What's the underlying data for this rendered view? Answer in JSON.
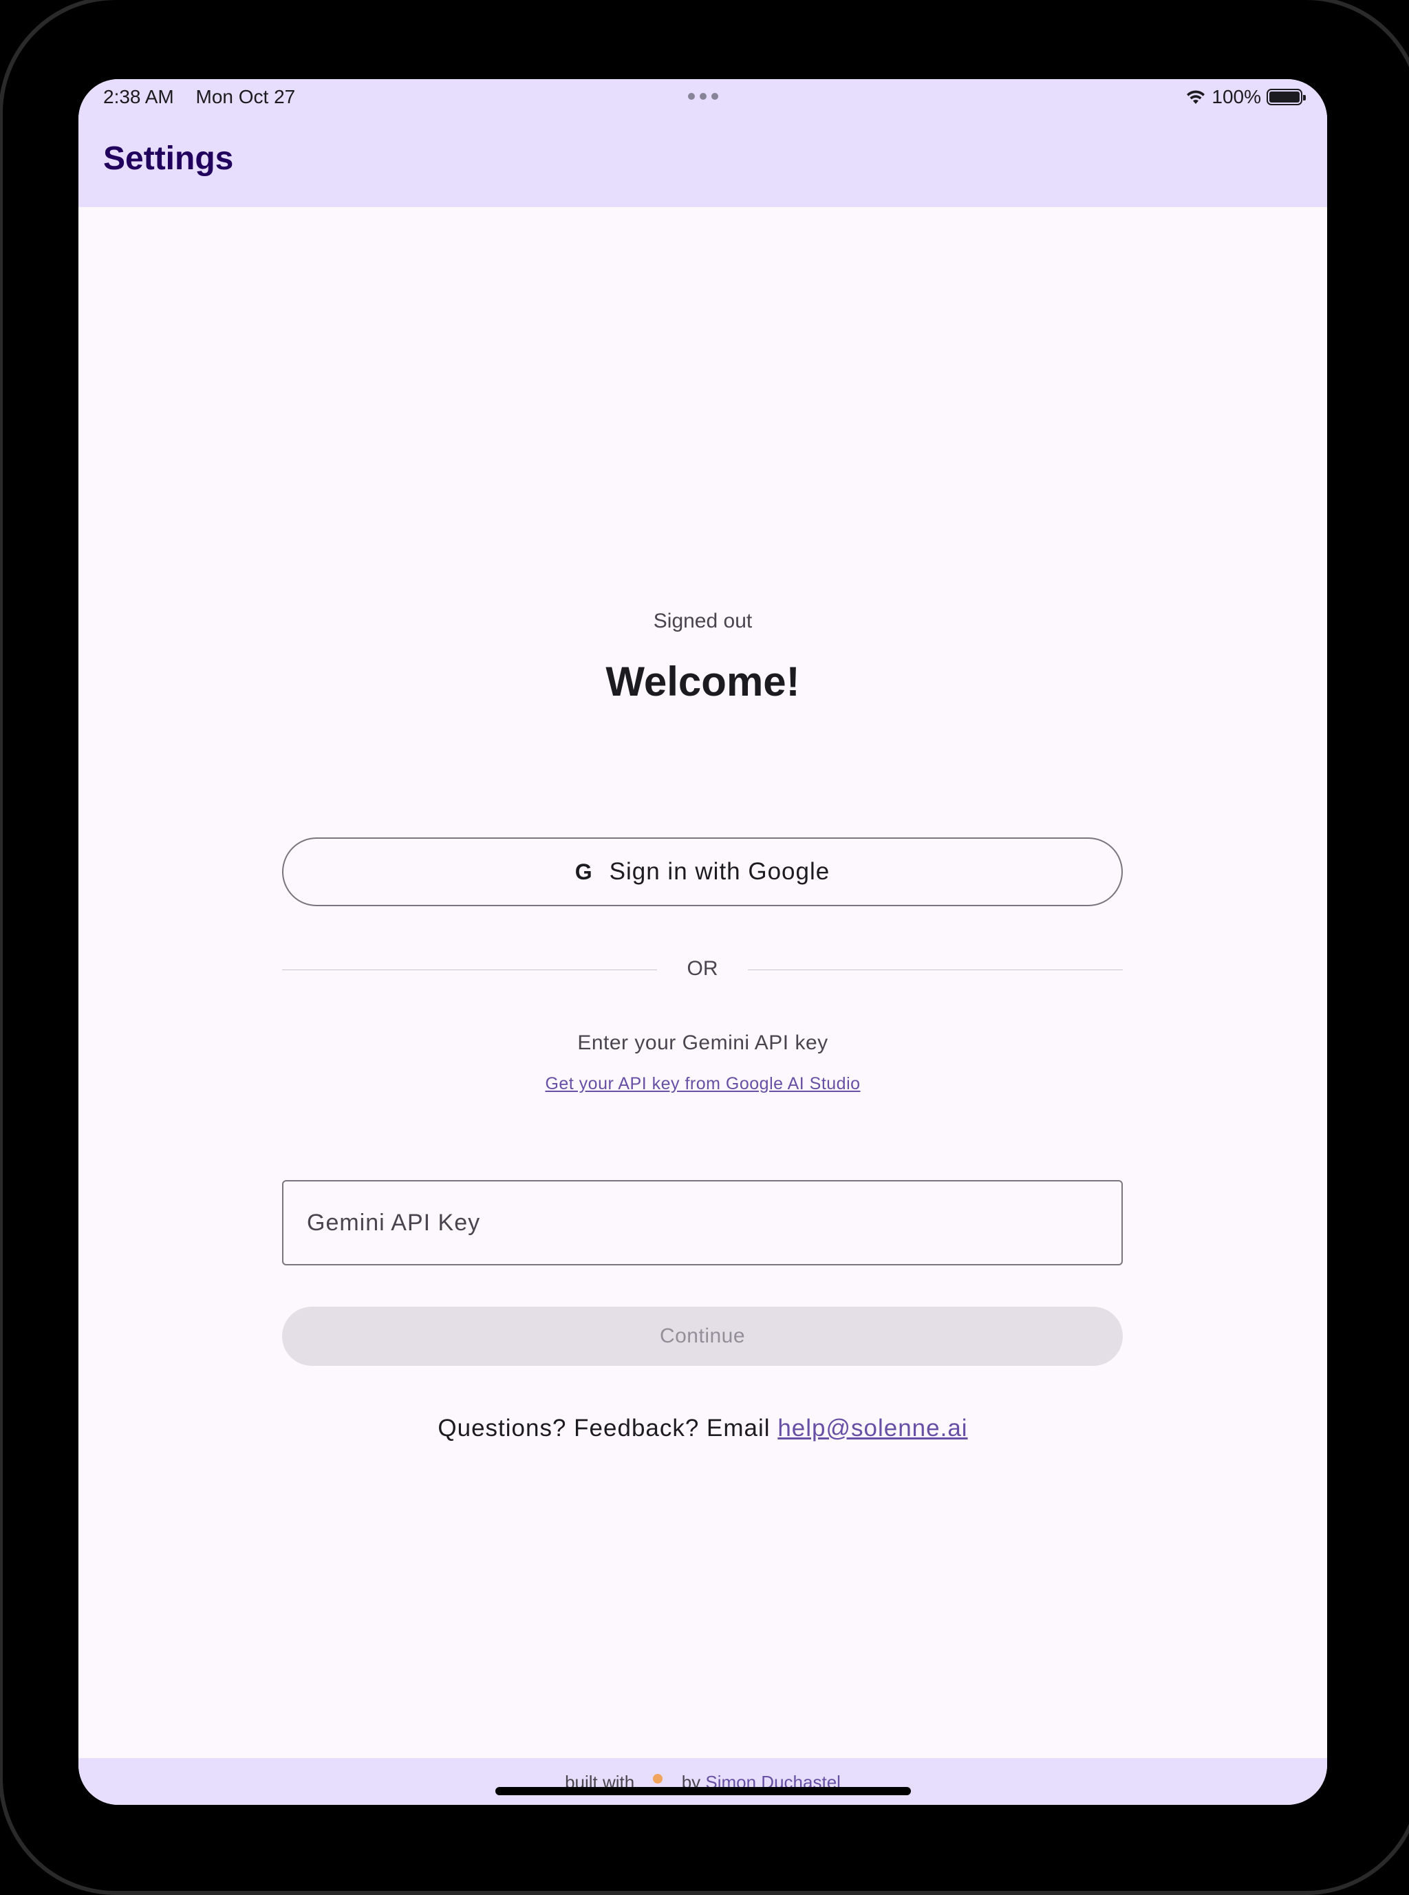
{
  "status_bar": {
    "time": "2:38 AM",
    "date": "Mon Oct 27",
    "battery": "100%",
    "battery_level": 1.0
  },
  "app_bar": {
    "title": "Settings"
  },
  "auth": {
    "status": "Signed out",
    "welcome": "Welcome!",
    "google_icon": "G",
    "google_button": "Sign in with Google",
    "divider": "OR",
    "api_prompt": "Enter your Gemini API key",
    "api_link": "Get your API key from Google AI Studio",
    "api_placeholder": "Gemini API Key",
    "api_value": "",
    "continue": "Continue"
  },
  "feedback": {
    "text": "Questions? Feedback? Email",
    "email": "help@solenne.ai"
  },
  "footer": {
    "built_with": "built with",
    "by": "by",
    "author": "Simon Duchastel"
  },
  "colors": {
    "header_bg": "#e7defe",
    "surface": "#fdf8fe",
    "title": "#21005d",
    "link": "#6750a4",
    "disabled_bg": "#e4dfe6"
  }
}
